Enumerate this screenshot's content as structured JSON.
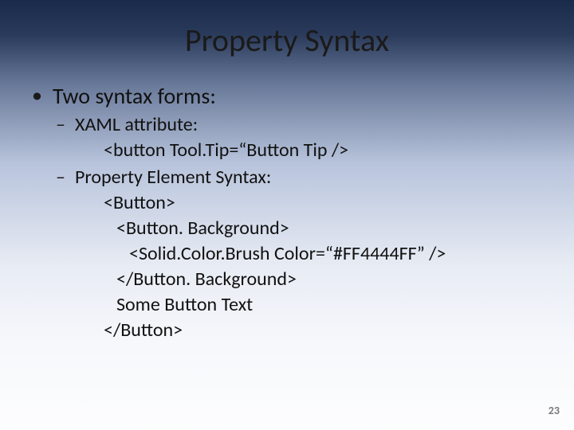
{
  "title": "Property Syntax",
  "bullet1": "Two syntax forms:",
  "sub1": "XAML attribute:",
  "code1": "<button Tool.Tip=“Button Tip />",
  "sub2": "Property Element Syntax:",
  "code2": "<Button>",
  "code3": "<Button. Background>",
  "code4": "<Solid.Color.Brush Color=“#FF4444FF” />",
  "code5": "</Button. Background>",
  "code6": "Some Button Text",
  "code7": "</Button>",
  "page_number": "23"
}
